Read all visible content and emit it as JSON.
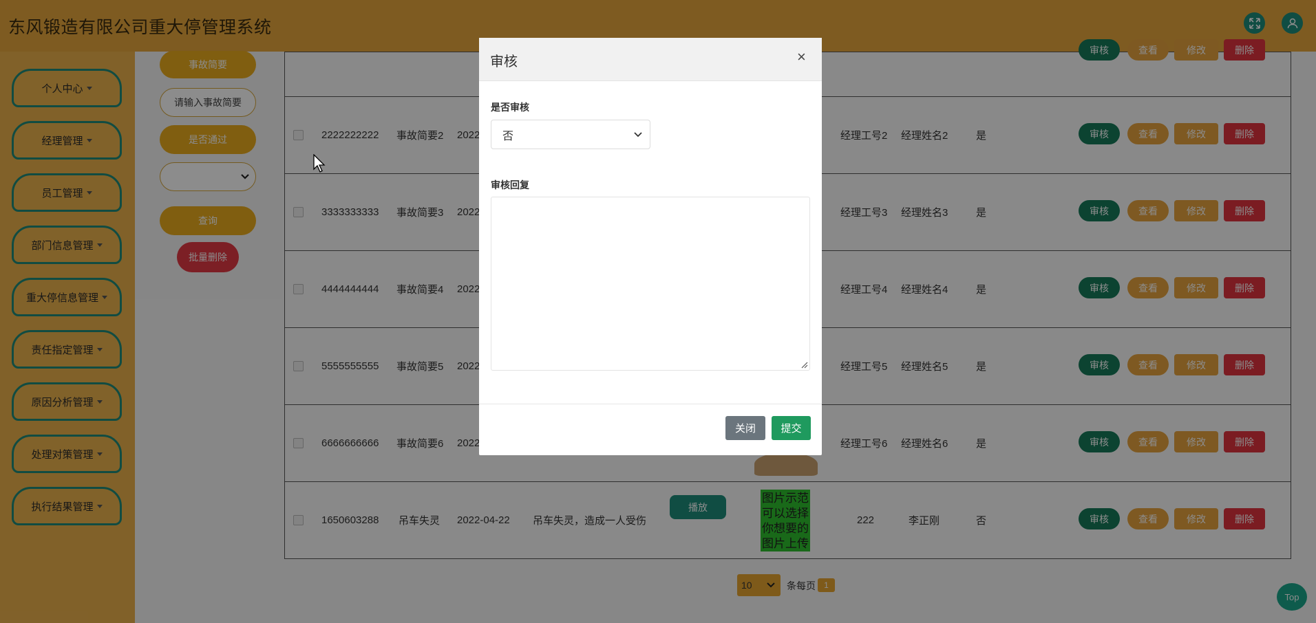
{
  "header": {
    "title": "东风锻造有限公司重大停管理系统"
  },
  "sidebar": {
    "items": [
      {
        "label": "个人中心"
      },
      {
        "label": "经理管理"
      },
      {
        "label": "员工管理"
      },
      {
        "label": "部门信息管理"
      },
      {
        "label": "重大停信息管理"
      },
      {
        "label": "责任指定管理"
      },
      {
        "label": "原因分析管理"
      },
      {
        "label": "处理对策管理"
      },
      {
        "label": "执行结果管理"
      }
    ]
  },
  "filter": {
    "label_summary": "事故简要",
    "input_placeholder": "请输入事故简要",
    "label_passed": "是否通过",
    "query": "查询",
    "batch_delete": "批量删除"
  },
  "actions": {
    "audit": "审核",
    "view": "查看",
    "edit": "修改",
    "delete": "删除",
    "play": "播放"
  },
  "rows": [
    {
      "id": "2222222222",
      "summary": "事故简要2",
      "date": "2022",
      "mgr_no": "经理工号2",
      "mgr_name": "经理姓名2",
      "passed": "是"
    },
    {
      "id": "3333333333",
      "summary": "事故简要3",
      "date": "2022",
      "mgr_no": "经理工号3",
      "mgr_name": "经理姓名3",
      "passed": "是"
    },
    {
      "id": "4444444444",
      "summary": "事故简要4",
      "date": "2022",
      "mgr_no": "经理工号4",
      "mgr_name": "经理姓名4",
      "passed": "是"
    },
    {
      "id": "5555555555",
      "summary": "事故简要5",
      "date": "2022",
      "mgr_no": "经理工号5",
      "mgr_name": "经理姓名5",
      "passed": "是"
    },
    {
      "id": "6666666666",
      "summary": "事故简要6",
      "date": "2022",
      "mgr_no": "经理工号6",
      "mgr_name": "经理姓名6",
      "passed": "是"
    },
    {
      "id": "1650603288",
      "summary": "吊车失灵",
      "date": "2022-04-22",
      "desc": "吊车失灵，造成一人受伤",
      "mgr_no": "222",
      "mgr_name": "李正刚",
      "passed": "否",
      "image_text": "图片示范可以选择你想要的图片上传"
    }
  ],
  "pager": {
    "page_size": "10",
    "per_page_label": "条每页",
    "page": "1"
  },
  "top_label": "Top",
  "modal": {
    "title": "审核",
    "close_x": "×",
    "field_audit_label": "是否审核",
    "audit_value": "否",
    "field_reply_label": "审核回复",
    "btn_close": "关闭",
    "btn_submit": "提交"
  }
}
